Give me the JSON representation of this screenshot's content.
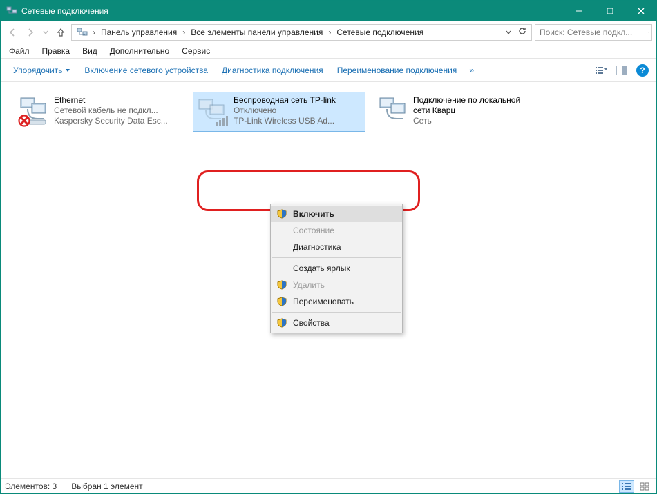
{
  "window": {
    "title": "Сетевые подключения"
  },
  "breadcrumb": {
    "items": [
      "Панель управления",
      "Все элементы панели управления",
      "Сетевые подключения"
    ]
  },
  "search": {
    "placeholder": "Поиск: Сетевые подкл..."
  },
  "menubar": {
    "items": [
      "Файл",
      "Правка",
      "Вид",
      "Дополнительно",
      "Сервис"
    ]
  },
  "toolbar": {
    "organize": "Упорядочить",
    "enable": "Включение сетевого устройства",
    "diagnose": "Диагностика подключения",
    "rename": "Переименование подключения",
    "overflow": "»"
  },
  "connections": [
    {
      "name": "Ethernet",
      "status": "Сетевой кабель не подкл...",
      "detail": "Kaspersky Security Data Esc...",
      "state": "disconnected"
    },
    {
      "name": "Беспроводная сеть TP-link",
      "status": "Отключено",
      "detail": "TP-Link Wireless USB Ad...",
      "state": "disabled",
      "selected": true
    },
    {
      "name": "Подключение по локальной сети Кварц",
      "status": "Сеть",
      "detail": "",
      "state": "ok"
    }
  ],
  "context_menu": {
    "items": [
      {
        "label": "Включить",
        "shield": true,
        "disabled": false,
        "hover": true
      },
      {
        "label": "Состояние",
        "shield": false,
        "disabled": true
      },
      {
        "label": "Диагностика",
        "shield": false,
        "disabled": false
      },
      {
        "sep": true
      },
      {
        "label": "Создать ярлык",
        "shield": false,
        "disabled": false
      },
      {
        "label": "Удалить",
        "shield": true,
        "disabled": true
      },
      {
        "label": "Переименовать",
        "shield": true,
        "disabled": false
      },
      {
        "sep": true
      },
      {
        "label": "Свойства",
        "shield": true,
        "disabled": false
      }
    ]
  },
  "statusbar": {
    "count": "Элементов: 3",
    "selected": "Выбран 1 элемент"
  }
}
